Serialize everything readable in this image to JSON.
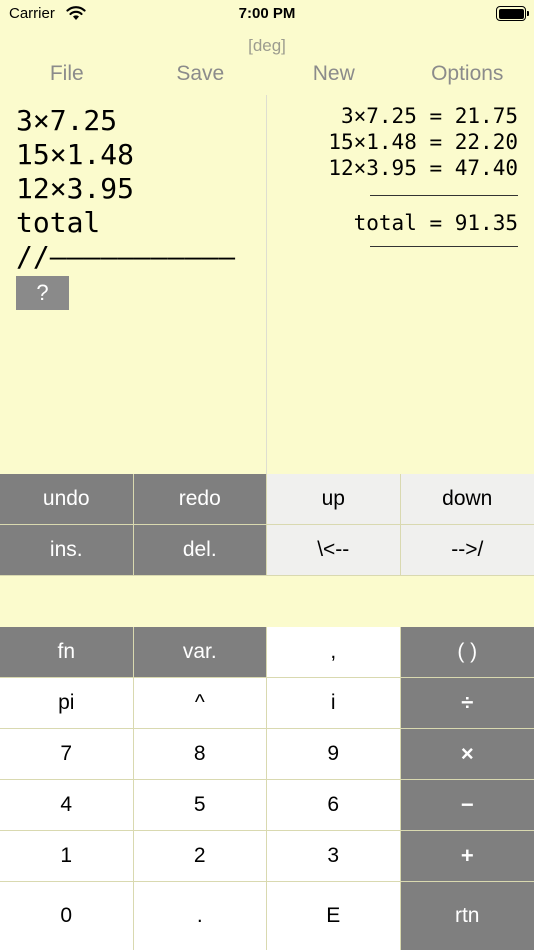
{
  "status": {
    "carrier": "Carrier",
    "time": "7:00 PM"
  },
  "mode": "[deg]",
  "menu": [
    "File",
    "Save",
    "New",
    "Options"
  ],
  "editor": {
    "lines": [
      "3×7.25",
      "15×1.48",
      "12×3.95",
      "total",
      "//———————————"
    ],
    "cursor_label": "?"
  },
  "results": {
    "lines": [
      "3×7.25 = 21.75",
      "15×1.48 = 22.20",
      "12×3.95 = 47.40"
    ],
    "total": "total = 91.35"
  },
  "edit_keys": [
    [
      {
        "label": "undo",
        "style": "dark"
      },
      {
        "label": "redo",
        "style": "dark"
      },
      {
        "label": "up",
        "style": "light"
      },
      {
        "label": "down",
        "style": "light"
      }
    ],
    [
      {
        "label": "ins.",
        "style": "dark"
      },
      {
        "label": "del.",
        "style": "dark"
      },
      {
        "label": "\\<--",
        "style": "light"
      },
      {
        "label": "-->/",
        "style": "light"
      }
    ]
  ],
  "keypad": [
    [
      {
        "label": "fn",
        "style": "dark"
      },
      {
        "label": "var.",
        "style": "dark"
      },
      {
        "label": ",",
        "style": "white"
      },
      {
        "label": "( )",
        "style": "dark"
      }
    ],
    [
      {
        "label": "pi",
        "style": "white"
      },
      {
        "label": "^",
        "style": "white"
      },
      {
        "label": "i",
        "style": "white"
      },
      {
        "label": "÷",
        "style": "op"
      }
    ],
    [
      {
        "label": "7",
        "style": "white"
      },
      {
        "label": "8",
        "style": "white"
      },
      {
        "label": "9",
        "style": "white"
      },
      {
        "label": "×",
        "style": "op"
      }
    ],
    [
      {
        "label": "4",
        "style": "white"
      },
      {
        "label": "5",
        "style": "white"
      },
      {
        "label": "6",
        "style": "white"
      },
      {
        "label": "−",
        "style": "op"
      }
    ],
    [
      {
        "label": "1",
        "style": "white"
      },
      {
        "label": "2",
        "style": "white"
      },
      {
        "label": "3",
        "style": "white"
      },
      {
        "label": "+",
        "style": "op"
      }
    ],
    [
      {
        "label": "0",
        "style": "white"
      },
      {
        "label": ".",
        "style": "white"
      },
      {
        "label": "E",
        "style": "white"
      },
      {
        "label": "rtn",
        "style": "dark"
      }
    ]
  ],
  "colors": {
    "background": "#fbfbcd",
    "key_dark": "#7f7f7f",
    "key_light": "#f0f0ee",
    "key_white": "#ffffff"
  }
}
